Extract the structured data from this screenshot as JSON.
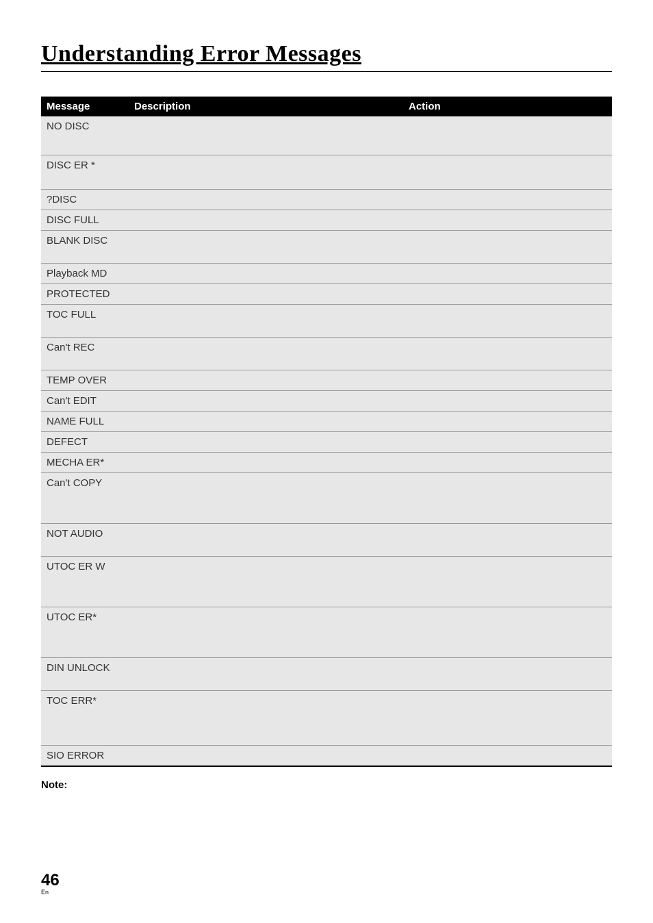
{
  "title": "Understanding Error Messages",
  "headers": {
    "message": "Message",
    "description": "Description",
    "action": "Action"
  },
  "rows": [
    {
      "message": "NO DISC",
      "description": "",
      "action": "",
      "hcls": "row-h1"
    },
    {
      "message": "DISC ER *",
      "description": "",
      "action": "",
      "hcls": "row-h2"
    },
    {
      "message": "?DISC",
      "description": "",
      "action": "",
      "hcls": "row-h3"
    },
    {
      "message": "DISC FULL",
      "description": "",
      "action": "",
      "hcls": "row-h3"
    },
    {
      "message": "BLANK DISC",
      "description": "",
      "action": "",
      "hcls": "row-h4"
    },
    {
      "message": "Playback MD",
      "description": "",
      "action": "",
      "hcls": "row-h3"
    },
    {
      "message": "PROTECTED",
      "description": "",
      "action": "",
      "hcls": "row-h3"
    },
    {
      "message": "TOC FULL",
      "description": "",
      "action": "",
      "hcls": "row-h4"
    },
    {
      "message": "Can't REC",
      "description": "",
      "action": "",
      "hcls": "row-h4"
    },
    {
      "message": "TEMP OVER",
      "description": "",
      "action": "",
      "hcls": "row-h3"
    },
    {
      "message": "Can't EDIT",
      "description": "",
      "action": "",
      "hcls": "row-h3"
    },
    {
      "message": "NAME FULL",
      "description": "",
      "action": "",
      "hcls": "row-h3"
    },
    {
      "message": "DEFECT",
      "description": "",
      "action": "",
      "hcls": "row-h3"
    },
    {
      "message": "MECHA ER*",
      "description": "",
      "action": "",
      "hcls": "row-h3"
    },
    {
      "message": "Can't COPY",
      "description": "",
      "action": "",
      "hcls": "row-h5"
    },
    {
      "message": "NOT AUDIO",
      "description": "",
      "action": "",
      "hcls": "row-h4"
    },
    {
      "message": "UTOC ER W",
      "description": "",
      "action": "",
      "hcls": "row-h5"
    },
    {
      "message": "UTOC ER*",
      "description": "",
      "action": "",
      "hcls": "row-h5"
    },
    {
      "message": "DIN UNLOCK",
      "description": "",
      "action": "",
      "hcls": "row-h4"
    },
    {
      "message": "TOC ERR*",
      "description": "",
      "action": "",
      "hcls": "row-h6"
    },
    {
      "message": "SIO ERROR",
      "description": "",
      "action": "",
      "hcls": "row-h3"
    }
  ],
  "note_label": "Note:",
  "page_number": "46",
  "page_lang": "En"
}
